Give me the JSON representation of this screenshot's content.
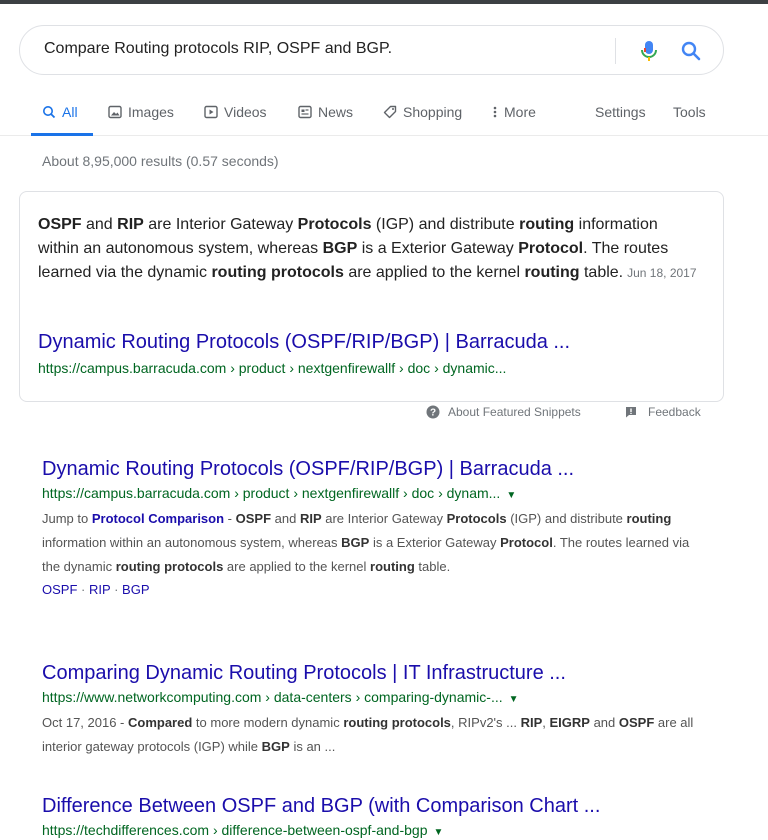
{
  "search": {
    "query": "Compare Routing protocols RIP, OSPF and BGP."
  },
  "tabs": [
    {
      "label": "All",
      "icon": "search-icon"
    },
    {
      "label": "Images",
      "icon": "image-icon"
    },
    {
      "label": "Videos",
      "icon": "video-icon"
    },
    {
      "label": "News",
      "icon": "news-icon"
    },
    {
      "label": "Shopping",
      "icon": "tag-icon"
    },
    {
      "label": "More",
      "icon": "more-vertical-icon"
    },
    {
      "label": "Settings"
    },
    {
      "label": "Tools"
    }
  ],
  "stats": "About 8,95,000 results (0.57 seconds)",
  "featured_snippet": {
    "date": "Jun 18, 2017",
    "title": "Dynamic Routing Protocols (OSPF/RIP/BGP) | Barracuda ...",
    "url": "https://campus.barracuda.com › product › nextgenfirewallf › doc › dynamic..."
  },
  "snippet_footer": {
    "about": "About Featured Snippets",
    "feedback": "Feedback"
  },
  "results": [
    {
      "title": "Dynamic Routing Protocols (OSPF/RIP/BGP) | Barracuda ...",
      "url": "https://campus.barracuda.com › product › nextgenfirewallf › doc › dynam...",
      "sitelinks": [
        "OSPF",
        "RIP",
        "BGP"
      ]
    },
    {
      "title": "Comparing Dynamic Routing Protocols | IT Infrastructure ...",
      "url": "https://www.networkcomputing.com › data-centers › comparing-dynamic-..."
    },
    {
      "title": "Difference Between OSPF and BGP (with Comparison Chart ...",
      "url": "https://techdifferences.com › difference-between-ospf-and-bgp"
    }
  ],
  "colors": {
    "link": "#1a0dab",
    "url": "#006621",
    "accent": "#1a73e8",
    "muted": "#70757a"
  }
}
